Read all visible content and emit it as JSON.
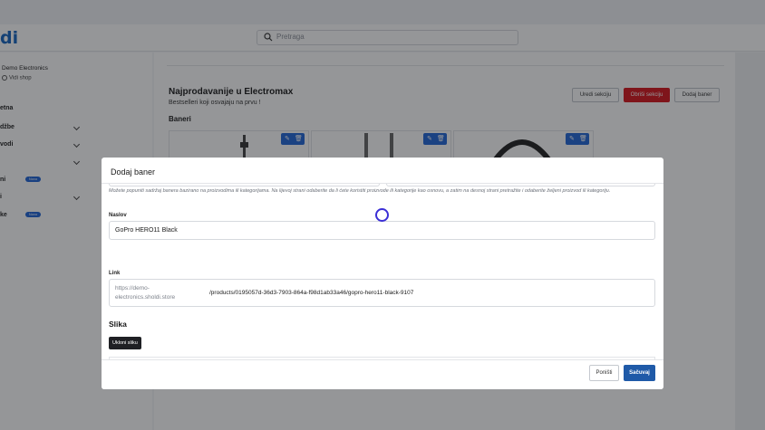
{
  "header": {
    "logo": "di",
    "search_placeholder": "Pretraga"
  },
  "sidebar": {
    "store_name": "Demo Electronics",
    "store_link": "Vidi shop",
    "items": [
      {
        "label": "etna",
        "has_chevron": false
      },
      {
        "label": "džbe",
        "has_chevron": true
      },
      {
        "label": "vodi",
        "has_chevron": true
      },
      {
        "label": "",
        "has_chevron": true
      },
      {
        "label": "ni",
        "badge": "Novo"
      },
      {
        "label": "i",
        "has_chevron": true
      },
      {
        "label": "ke",
        "badge": "Novo"
      }
    ]
  },
  "section": {
    "title": "Najprodavanije u Electromax",
    "subtitle": "Bestselleri koji osvajaju na prvu !",
    "banners_label": "Baneri",
    "edit_label": "Uredi sekciju",
    "delete_label": "Obriši sekciju",
    "add_banner_label": "Dodaj baner"
  },
  "modal": {
    "title": "Dodaj baner",
    "hint": "Možete popuniti sadržaj banera bazirano na proizvodima ili kategorijama. Na lijevoj strani odaberite da li ćete koristiti proizvode ili kategorije kao osnovu, a zatim na desnoj strani pretražite i odaberite željeni proizvod ili kategoriju.",
    "title_label": "Naslov",
    "title_value": "GoPro HERO11 Black",
    "link_label": "Link",
    "link_prefix": "https://demo-electronics.sholdi.store",
    "link_path": "/products/0195057d-36d3-7903-864a-f98d1ab33a46/gopro-hero11-black-9107",
    "image_label": "Slika",
    "remove_image_label": "Ukloni sliku",
    "cancel_label": "Poništi",
    "save_label": "Sačuvaj"
  }
}
